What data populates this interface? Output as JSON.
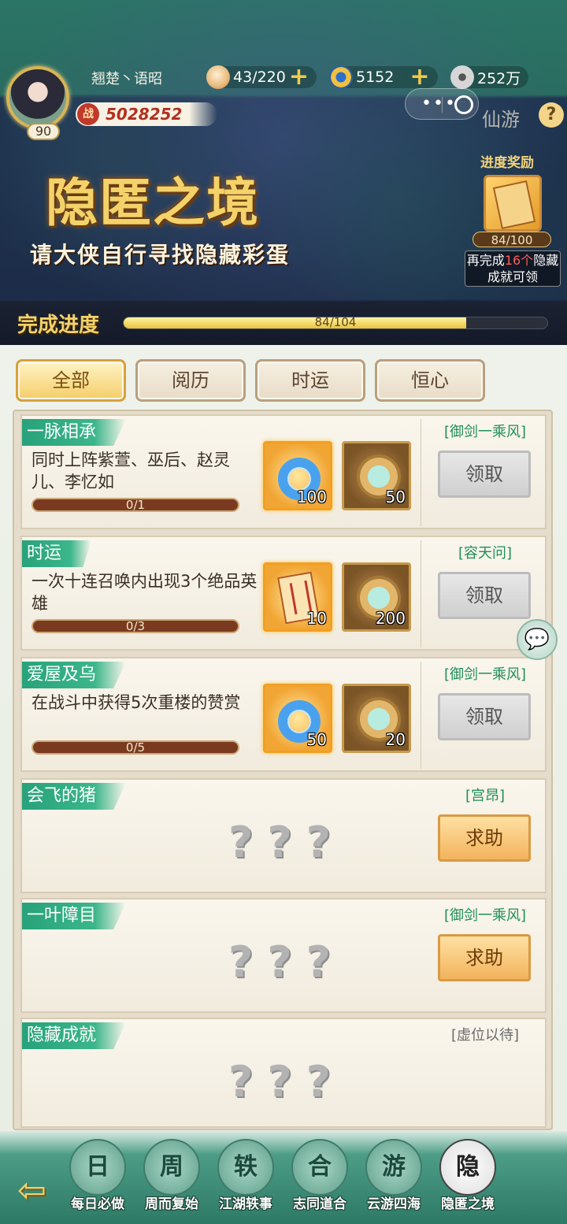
{
  "header": {
    "player_name": "翘楚丶语昭",
    "level": "90",
    "power_label": "战",
    "power": "5028252",
    "resources": [
      {
        "icon": "bun-icon",
        "value": "43/220"
      },
      {
        "icon": "jade-icon",
        "value": "5152"
      },
      {
        "icon": "coin-icon",
        "value": "252万"
      }
    ],
    "brand": "仙游",
    "help": "?"
  },
  "banner": {
    "title": "隐匿之境",
    "subtitle": "请大侠自行寻找隐藏彩蛋",
    "reward_label": "进度奖励",
    "reward_progress": "84/100",
    "reward_tip_prefix": "再完成",
    "reward_tip_count": "16个",
    "reward_tip_suffix": "隐藏成就可领"
  },
  "progress": {
    "label": "完成进度",
    "text": "84/104",
    "fraction": 0.8077
  },
  "tabs": [
    "全部",
    "阅历",
    "时运",
    "恒心"
  ],
  "cards": [
    {
      "title": "一脉相承",
      "desc": "同时上阵紫萱、巫后、赵灵儿、李忆如",
      "progress": "0/1",
      "rewards": [
        {
          "icon": "jade-ring-icon",
          "count": "100"
        },
        {
          "icon": "medal-icon",
          "count": "50"
        }
      ],
      "reward_name": "[御剑一乘风]",
      "button": "领取"
    },
    {
      "title": "时运",
      "desc": "一次十连召唤内出现3个绝品英雄",
      "progress": "0/3",
      "rewards": [
        {
          "icon": "edict-icon",
          "count": "10"
        },
        {
          "icon": "medal-icon",
          "count": "200"
        }
      ],
      "reward_name": "[容天问]",
      "button": "领取"
    },
    {
      "title": "爱屋及乌",
      "desc": "在战斗中获得5次重楼的赞赏",
      "progress": "0/5",
      "rewards": [
        {
          "icon": "jade-ring-icon",
          "count": "50"
        },
        {
          "icon": "medal-icon",
          "count": "20"
        }
      ],
      "reward_name": "[御剑一乘风]",
      "button": "领取"
    },
    {
      "title": "会飞的猪",
      "hidden": "???",
      "reward_name": "[宫昂]",
      "button": "求助"
    },
    {
      "title": "一叶障目",
      "hidden": "???",
      "reward_name": "[御剑一乘风]",
      "button": "求助"
    },
    {
      "title": "隐藏成就",
      "hidden": "???",
      "reward_name": "[虚位以待]"
    }
  ],
  "nav": [
    {
      "icon": "daily-icon",
      "label": "每日必做",
      "glyph": "日"
    },
    {
      "icon": "weekly-icon",
      "label": "周而复始",
      "glyph": "周"
    },
    {
      "icon": "anecdote-icon",
      "label": "江湖轶事",
      "glyph": "轶"
    },
    {
      "icon": "companion-icon",
      "label": "志同道合",
      "glyph": "合"
    },
    {
      "icon": "travel-icon",
      "label": "云游四海",
      "glyph": "游"
    },
    {
      "icon": "hidden-icon",
      "label": "隐匿之境",
      "glyph": "隐"
    }
  ],
  "colors": {
    "accent_green": "#27a27a",
    "gold": "#f3d26a",
    "reward_green": "#1f8e58",
    "tip_red": "#ff5a5a"
  }
}
